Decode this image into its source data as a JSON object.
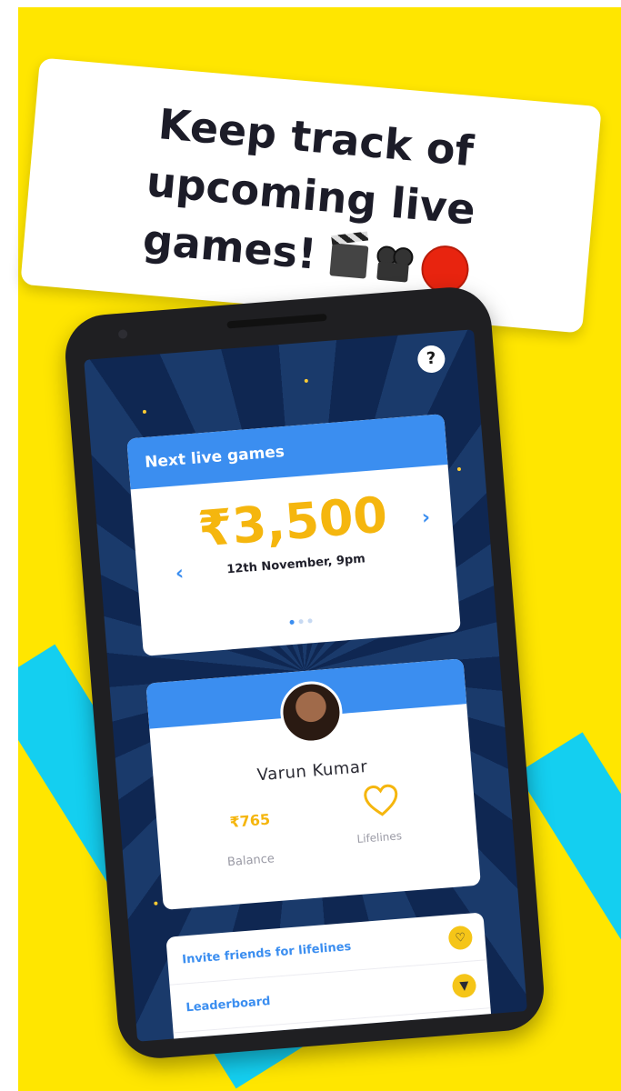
{
  "caption": {
    "text": "Keep track of upcoming live games!",
    "icons": [
      "clapperboard-icon",
      "movie-camera-icon",
      "red-circle-icon"
    ]
  },
  "phone": {
    "help_label": "?",
    "games_card": {
      "title": "Next live games",
      "prize": "₹3,500",
      "date": "12th November, 9pm",
      "prev_arrow": "‹",
      "next_arrow": "›",
      "pager": {
        "count": 3,
        "active_index": 0
      }
    },
    "profile_card": {
      "name": "Varun Kumar",
      "balance_value": "₹765",
      "balance_label": "Balance",
      "lifelines_label": "Lifelines"
    },
    "menu": {
      "items": [
        {
          "label": "Invite friends for lifelines",
          "icon": "heart-icon"
        },
        {
          "label": "Leaderboard",
          "icon": "trophy-icon"
        }
      ]
    }
  },
  "colors": {
    "background": "#ffe600",
    "stripe": "#14cff0",
    "accent_blue": "#3b8ef0",
    "prize_gold": "#f5b60e",
    "record_red": "#e8240f"
  }
}
